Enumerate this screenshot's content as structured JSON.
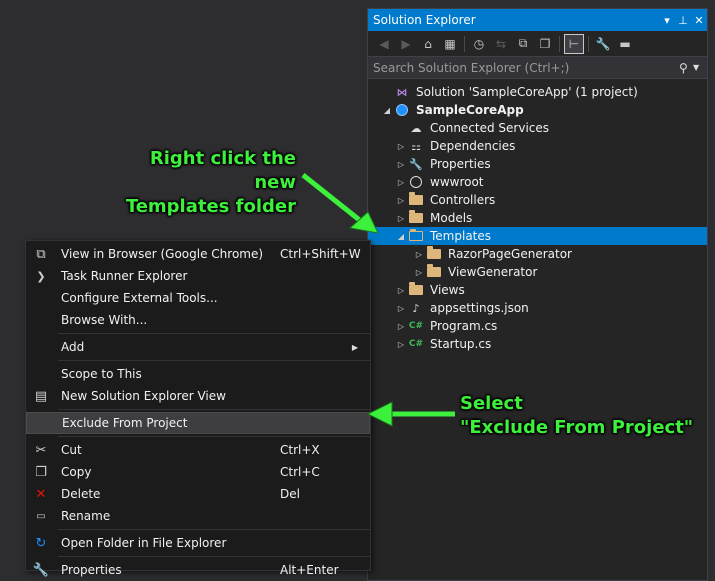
{
  "solution_explorer": {
    "title": "Solution Explorer",
    "title_controls": [
      "▾",
      "⊥",
      "✕"
    ],
    "search_placeholder": "Search Solution Explorer (Ctrl+;)",
    "tree": [
      {
        "label": "Solution 'SampleCoreApp' (1 project)",
        "icon": "solution-icon",
        "indent": 0,
        "arrow": "",
        "bold": false
      },
      {
        "label": "SampleCoreApp",
        "icon": "project-icon",
        "indent": 0,
        "arrow": "◢",
        "bold": true
      },
      {
        "label": "Connected Services",
        "icon": "cloud-icon",
        "indent": 1,
        "arrow": "",
        "bold": false
      },
      {
        "label": "Dependencies",
        "icon": "dependencies-icon",
        "indent": 1,
        "arrow": "▷",
        "bold": false
      },
      {
        "label": "Properties",
        "icon": "wrench-icon",
        "indent": 1,
        "arrow": "▷",
        "bold": false
      },
      {
        "label": "wwwroot",
        "icon": "globe-icon",
        "indent": 1,
        "arrow": "▷",
        "bold": false
      },
      {
        "label": "Controllers",
        "icon": "folder-icon",
        "indent": 1,
        "arrow": "▷",
        "bold": false
      },
      {
        "label": "Models",
        "icon": "folder-icon",
        "indent": 1,
        "arrow": "▷",
        "bold": false
      },
      {
        "label": "Templates",
        "icon": "folder-open-icon",
        "indent": 1,
        "arrow": "◢",
        "bold": false,
        "selected": true
      },
      {
        "label": "RazorPageGenerator",
        "icon": "folder-icon",
        "indent": 2,
        "arrow": "▷",
        "bold": false
      },
      {
        "label": "ViewGenerator",
        "icon": "folder-icon",
        "indent": 2,
        "arrow": "▷",
        "bold": false
      },
      {
        "label": "Views",
        "icon": "folder-icon",
        "indent": 1,
        "arrow": "▷",
        "bold": false
      },
      {
        "label": "appsettings.json",
        "icon": "json-icon",
        "indent": 1,
        "arrow": "▷",
        "bold": false
      },
      {
        "label": "Program.cs",
        "icon": "csharp-icon",
        "indent": 1,
        "arrow": "▷",
        "bold": false
      },
      {
        "label": "Startup.cs",
        "icon": "csharp-icon",
        "indent": 1,
        "arrow": "▷",
        "bold": false
      }
    ]
  },
  "context_menu": {
    "items": [
      {
        "label": "View in Browser (Google Chrome)",
        "shortcut": "Ctrl+Shift+W",
        "icon": "browser-icon"
      },
      {
        "label": "Task Runner Explorer",
        "shortcut": "",
        "icon": "chevron-right-icon"
      },
      {
        "label": "Configure External Tools...",
        "shortcut": "",
        "icon": ""
      },
      {
        "label": "Browse With...",
        "shortcut": "",
        "icon": ""
      },
      {
        "sep": true
      },
      {
        "label": "Add",
        "shortcut": "",
        "icon": "",
        "submenu": true
      },
      {
        "sep": true
      },
      {
        "label": "Scope to This",
        "shortcut": "",
        "icon": ""
      },
      {
        "label": "New Solution Explorer View",
        "shortcut": "",
        "icon": "new-view-icon"
      },
      {
        "sep": true
      },
      {
        "label": "Exclude From Project",
        "shortcut": "",
        "icon": "",
        "highlight": true
      },
      {
        "sep": true
      },
      {
        "label": "Cut",
        "shortcut": "Ctrl+X",
        "icon": "scissors-icon"
      },
      {
        "label": "Copy",
        "shortcut": "Ctrl+C",
        "icon": "copy-icon"
      },
      {
        "label": "Delete",
        "shortcut": "Del",
        "icon": "delete-icon"
      },
      {
        "label": "Rename",
        "shortcut": "",
        "icon": "rename-icon"
      },
      {
        "sep": true
      },
      {
        "label": "Open Folder in File Explorer",
        "shortcut": "",
        "icon": "refresh-icon"
      },
      {
        "sep": true
      },
      {
        "label": "Properties",
        "shortcut": "Alt+Enter",
        "icon": "wrench-icon"
      }
    ]
  },
  "annotations": {
    "a1_line1": "Right click the new",
    "a1_line2": "Templates folder",
    "a2_line1": "Select",
    "a2_line2": "\"Exclude From Project\""
  },
  "colors": {
    "accent": "#007acc",
    "annotation": "#3cf03c",
    "background": "#2d2d30"
  }
}
